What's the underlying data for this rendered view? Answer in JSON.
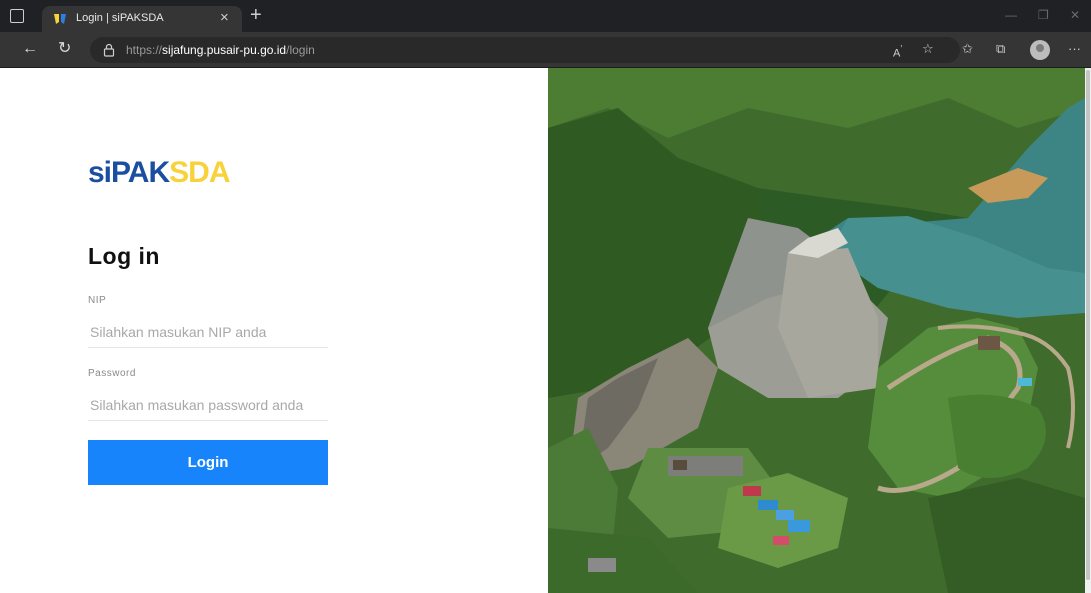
{
  "browser": {
    "tab_title": "Login | siPAKSDA",
    "url_protocol": "https://",
    "url_host": "sijafung.pusair-pu.go.id",
    "url_path": "/login"
  },
  "logo": {
    "part1": "siPAK",
    "part2": "SDA"
  },
  "form": {
    "heading": "Log in",
    "nip_label": "NIP",
    "nip_placeholder": "Silahkan masukan NIP anda",
    "password_label": "Password",
    "password_placeholder": "Silahkan masukan password anda",
    "login_label": "Login"
  },
  "colors": {
    "brand_blue": "#1b4ea0",
    "brand_yellow": "#f7d23b",
    "button": "#1784fb"
  }
}
